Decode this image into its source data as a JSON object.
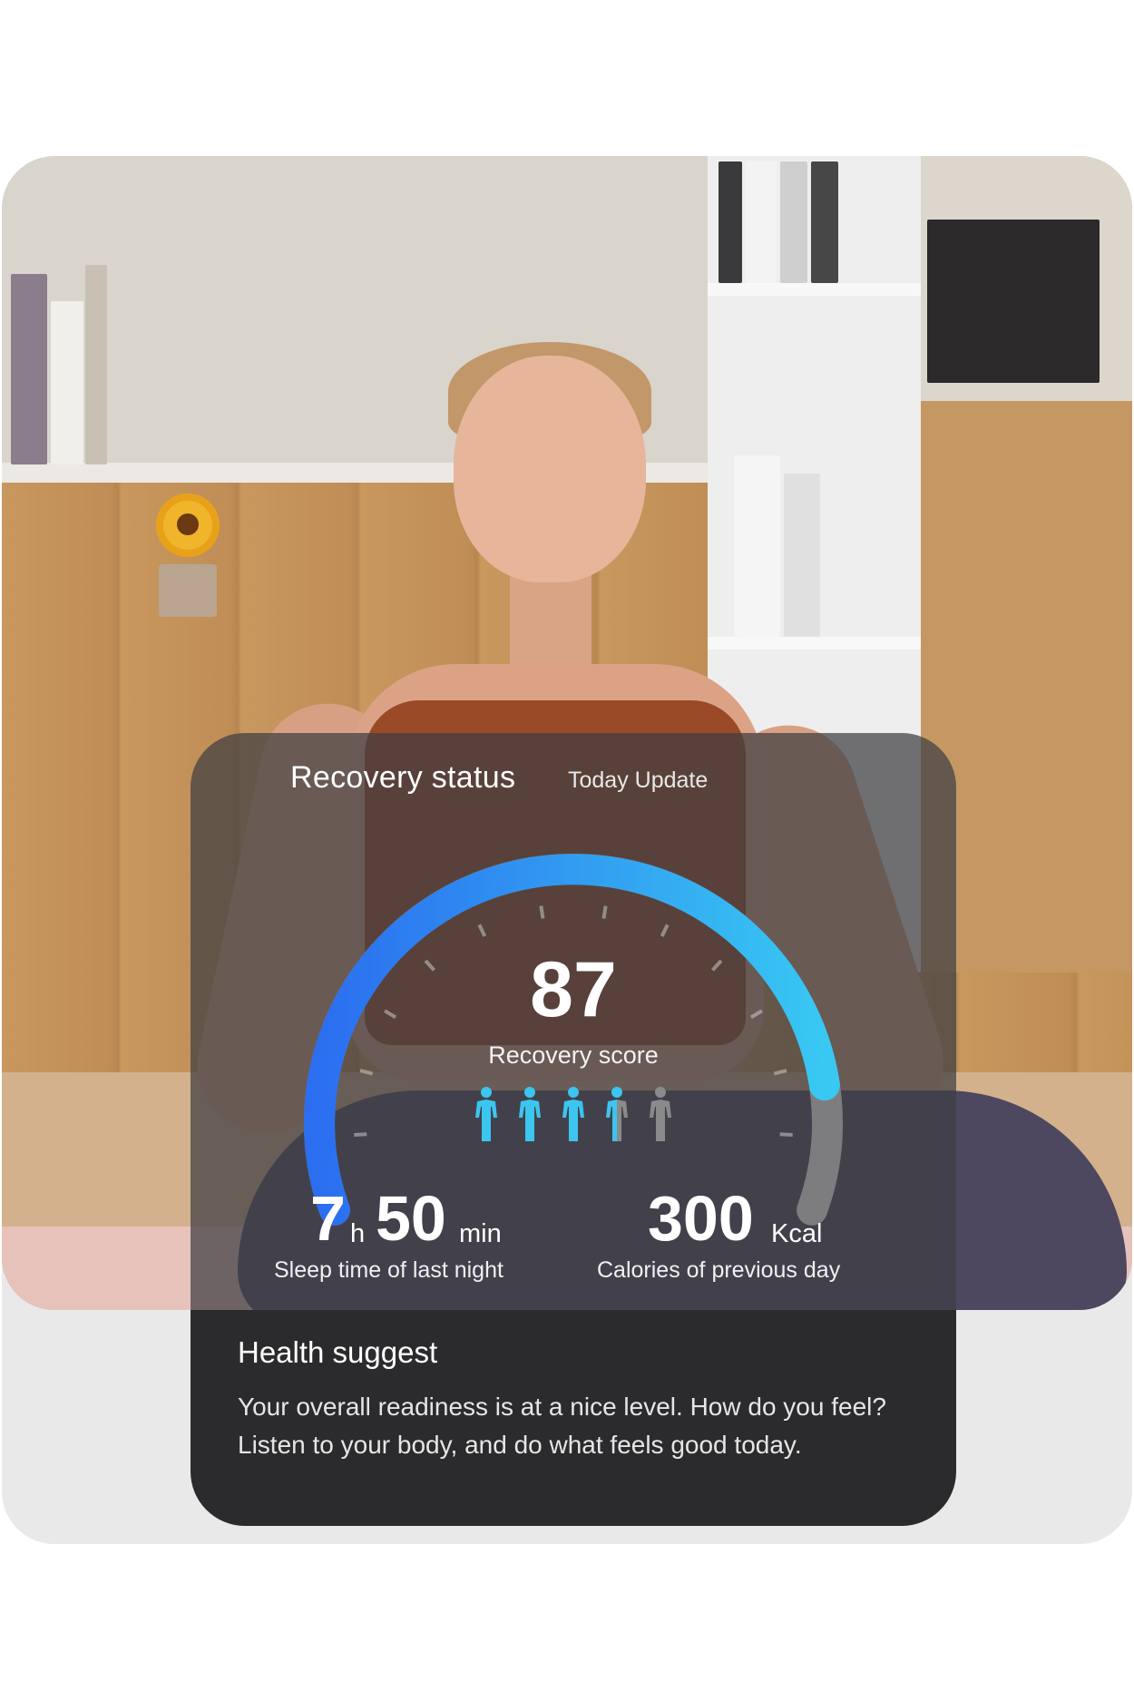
{
  "recovery": {
    "title": "Recovery status",
    "subtitle": "Today Update",
    "score": "87",
    "score_label": "Recovery score",
    "score_fraction": 0.87,
    "figure_icons": [
      "person-icon-active",
      "person-icon-active",
      "person-icon-active",
      "person-icon-partial",
      "person-icon-inactive"
    ],
    "figures_active": 3.5,
    "figures_total": 5
  },
  "sleep": {
    "hours": "7",
    "hours_unit": "h",
    "minutes": "50",
    "minutes_unit": "min",
    "label": "Sleep time of last night"
  },
  "calories": {
    "value": "300",
    "unit": "Kcal",
    "label": "Calories of previous day"
  },
  "health": {
    "title": "Health suggest",
    "text": "Your overall readiness is at a nice level. How do you feel? Listen to your body, and do what feels good today."
  },
  "colors": {
    "gauge_start": "#2b6ef0",
    "gauge_end": "#38c8f2",
    "gauge_track": "#7d7d80",
    "figure_active": "#3cc5ef",
    "figure_inactive": "#8a8a8c"
  }
}
